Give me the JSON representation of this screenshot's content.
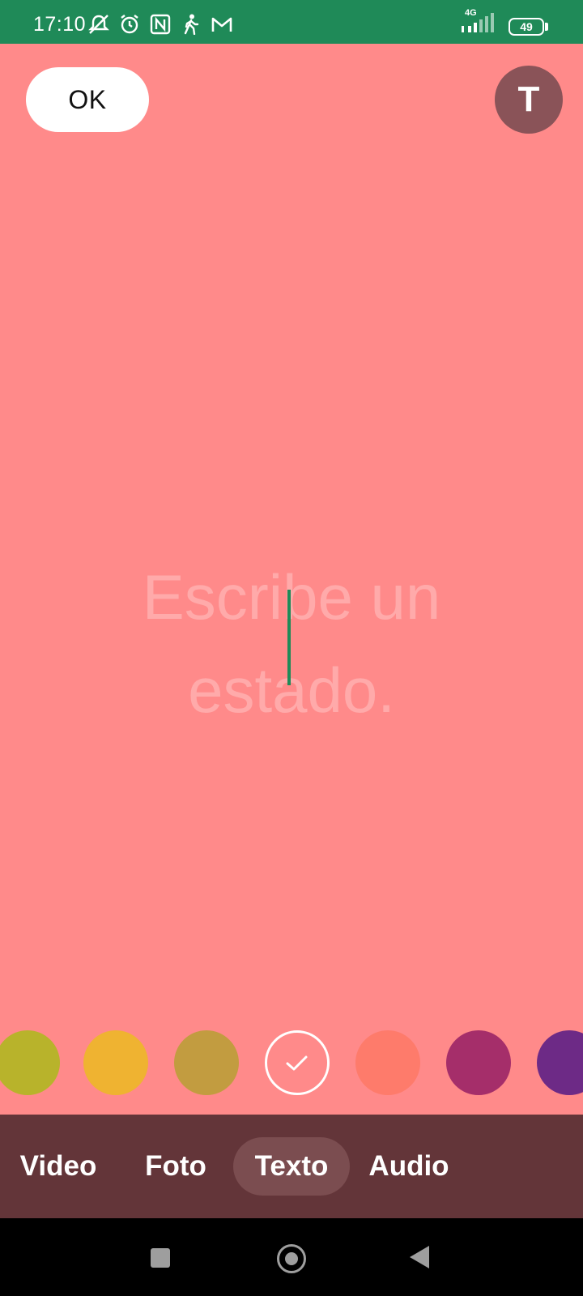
{
  "status_bar": {
    "time": "17:10",
    "network": "4G",
    "battery": "49",
    "icons": [
      "mute-icon",
      "alarm-icon",
      "nfc-icon",
      "walking-icon",
      "gmail-icon"
    ]
  },
  "toolbar": {
    "ok_label": "OK",
    "text_style_label": "T"
  },
  "editor": {
    "placeholder_line1": "Escribe un",
    "placeholder_line2": "estado."
  },
  "palette": {
    "colors": [
      "#b8b32b",
      "#efb331",
      "#c29c40",
      "#ff8a8a",
      "#fe7b6b",
      "#a52e6a",
      "#6d2a86"
    ],
    "selected_index": 3
  },
  "modes": {
    "video": "Video",
    "foto": "Foto",
    "texto": "Texto",
    "audio": "Audio",
    "active": "Texto"
  },
  "colors": {
    "status_bar": "#1f8a58",
    "background": "#ff8a8a",
    "mode_bar": "#633539"
  }
}
